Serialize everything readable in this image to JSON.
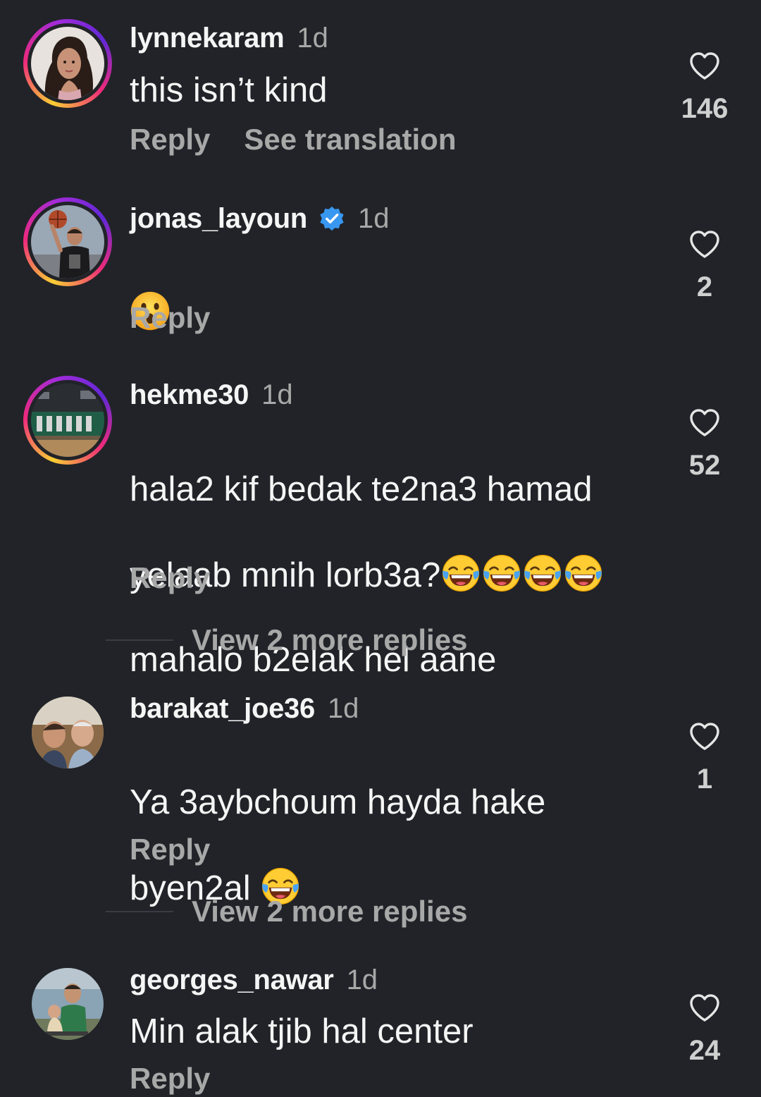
{
  "comments": [
    {
      "username": "lynnekaram",
      "time": "1d",
      "text": "this isn’t kind",
      "reply_label": "Reply",
      "translate_label": "See translation",
      "likes": "146",
      "avatar_icon": "profile-photo-woman",
      "story_ring": true
    },
    {
      "username": "jonas_layoun",
      "time": "1d",
      "verified": true,
      "emoji": "astonished-face",
      "reply_label": "Reply",
      "likes": "2",
      "avatar_icon": "profile-photo-basketball-player",
      "story_ring": true
    },
    {
      "username": "hekme30",
      "time": "1d",
      "text_line1": "hala2 kif bedak te2na3 hamad",
      "text_line2": "yelaab mnih lorb3a?",
      "text_line3": "mahalo b2elak hel aane",
      "emoji": "face-with-tears-of-joy",
      "emoji_count": 4,
      "reply_label": "Reply",
      "likes": "52",
      "view_more": "View 2 more replies",
      "avatar_icon": "profile-photo-team",
      "story_ring": true
    },
    {
      "username": "barakat_joe36",
      "time": "1d",
      "text_line1": "Ya 3aybchoum hayda hake",
      "text_line2": "byen2al ",
      "emoji": "face-with-tears-of-joy",
      "reply_label": "Reply",
      "likes": "1",
      "view_more": "View 2 more replies",
      "avatar_icon": "profile-photo-selfie",
      "story_ring": false
    },
    {
      "username": "georges_nawar",
      "time": "1d",
      "text": "Min alak tjib hal center",
      "reply_label": "Reply",
      "likes": "24",
      "avatar_icon": "profile-photo-family",
      "story_ring": false
    }
  ],
  "colors": {
    "background": "#212328",
    "primary_text": "#f5f5f5",
    "secondary_text": "#a8a8a8",
    "verified_blue": "#3897f0"
  }
}
